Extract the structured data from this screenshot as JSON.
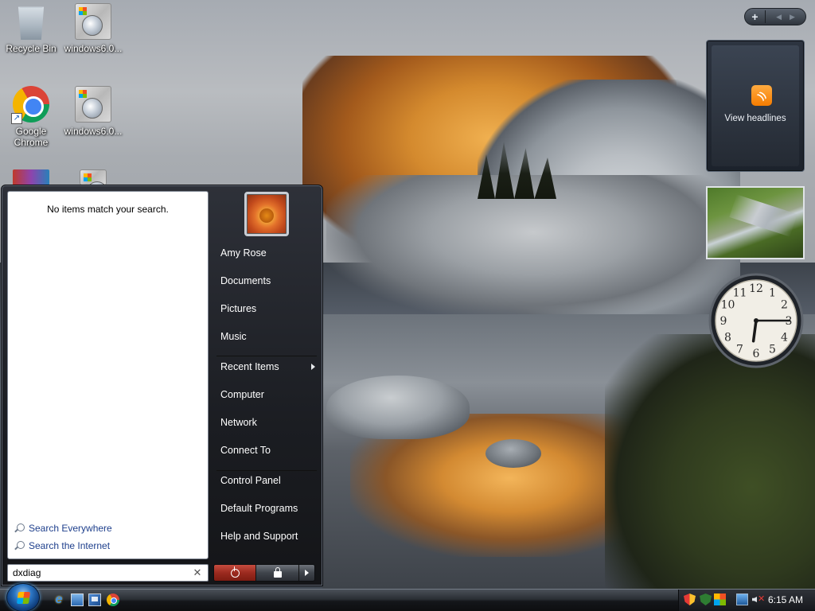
{
  "desktop": {
    "icons": [
      {
        "label": "Recycle Bin",
        "icon": "recycle-bin-icon"
      },
      {
        "label": "windows6.0...",
        "icon": "setup-package-icon"
      },
      {
        "label": "Google Chrome",
        "icon": "chrome-icon"
      },
      {
        "label": "windows6.0...",
        "icon": "setup-package-icon"
      },
      {
        "label": "",
        "icon": "winrar-icon"
      },
      {
        "label": "",
        "icon": "setup-package-icon"
      }
    ]
  },
  "gadgets": {
    "toolbar": {
      "add_label": "+",
      "prev_label": "◀",
      "next_label": "▶"
    },
    "feed": {
      "label": "View headlines",
      "rss_glyph": "))"
    },
    "clock": {
      "numbers": [
        "12",
        "1",
        "2",
        "3",
        "4",
        "5",
        "6",
        "7",
        "8",
        "9",
        "10",
        "11"
      ],
      "time": "6:15"
    }
  },
  "start_menu": {
    "results": {
      "message": "No items match your search.",
      "search_everywhere": "Search Everywhere",
      "search_internet": "Search the Internet"
    },
    "search": {
      "value": "dxdiag",
      "clear_glyph": "✕"
    },
    "user_name": "Amy Rose",
    "items": [
      {
        "label": "Amy Rose"
      },
      {
        "label": "Documents"
      },
      {
        "label": "Pictures"
      },
      {
        "label": "Music"
      },
      {
        "label": "Recent Items"
      },
      {
        "label": "Computer"
      },
      {
        "label": "Network"
      },
      {
        "label": "Connect To"
      },
      {
        "label": "Control Panel"
      },
      {
        "label": "Default Programs"
      },
      {
        "label": "Help and Support"
      }
    ]
  },
  "taskbar": {
    "ie_glyph": "e",
    "clock": "6:15 AM"
  },
  "colors": {
    "start_menu_bg": "#1b1d22",
    "link_blue": "#1e3f8c",
    "power_red": "#9b2a1f"
  }
}
